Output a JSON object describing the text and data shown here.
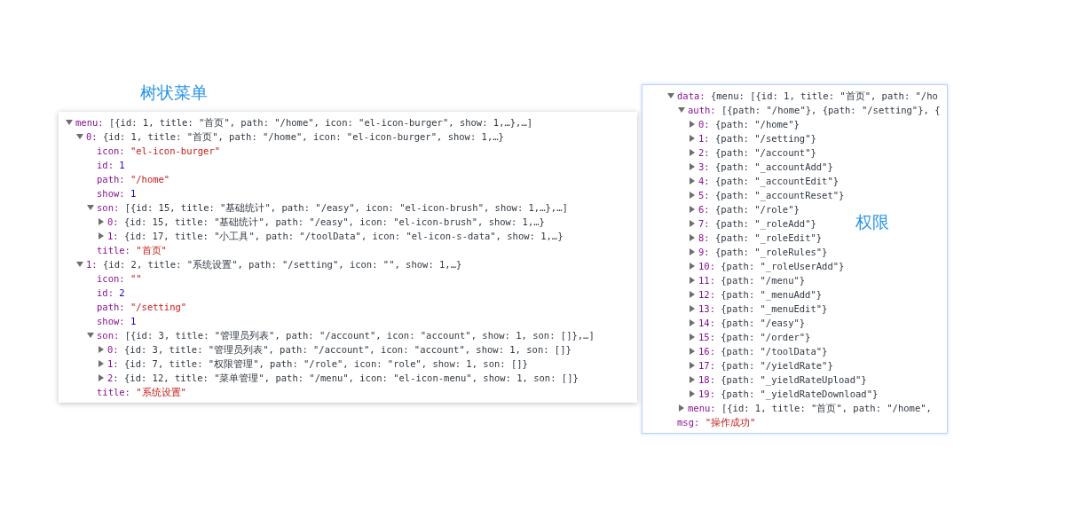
{
  "left": {
    "caption": "树状菜单",
    "tree": [
      {
        "key": "menu:",
        "value": "[{id: 1, title: \"首页\", path: \"/home\", icon: \"el-icon-burger\", show: 1,…},…]",
        "kind": "object",
        "expanded": true,
        "children": [
          {
            "key": "0:",
            "value": "{id: 1, title: \"首页\", path: \"/home\", icon: \"el-icon-burger\", show: 1,…}",
            "kind": "object",
            "expanded": true,
            "children": [
              {
                "key": "icon:",
                "value": "\"el-icon-burger\"",
                "kind": "string"
              },
              {
                "key": "id:",
                "value": "1",
                "kind": "number"
              },
              {
                "key": "path:",
                "value": "\"/home\"",
                "kind": "string"
              },
              {
                "key": "show:",
                "value": "1",
                "kind": "number"
              },
              {
                "key": "son:",
                "value": "[{id: 15, title: \"基础统计\", path: \"/easy\", icon: \"el-icon-brush\", show: 1,…},…]",
                "kind": "object",
                "expanded": true,
                "children": [
                  {
                    "key": "0:",
                    "value": "{id: 15, title: \"基础统计\", path: \"/easy\", icon: \"el-icon-brush\", show: 1,…}",
                    "kind": "object",
                    "expanded": false
                  },
                  {
                    "key": "1:",
                    "value": "{id: 17, title: \"小工具\", path: \"/toolData\", icon: \"el-icon-s-data\", show: 1,…}",
                    "kind": "object",
                    "expanded": false
                  }
                ]
              },
              {
                "key": "title:",
                "value": "\"首页\"",
                "kind": "string"
              }
            ]
          },
          {
            "key": "1:",
            "value": "{id: 2, title: \"系统设置\", path: \"/setting\", icon: \"\", show: 1,…}",
            "kind": "object",
            "expanded": true,
            "children": [
              {
                "key": "icon:",
                "value": "\"\"",
                "kind": "string"
              },
              {
                "key": "id:",
                "value": "2",
                "kind": "number"
              },
              {
                "key": "path:",
                "value": "\"/setting\"",
                "kind": "string"
              },
              {
                "key": "show:",
                "value": "1",
                "kind": "number"
              },
              {
                "key": "son:",
                "value": "[{id: 3, title: \"管理员列表\", path: \"/account\", icon: \"account\", show: 1, son: []},…]",
                "kind": "object",
                "expanded": true,
                "children": [
                  {
                    "key": "0:",
                    "value": "{id: 3, title: \"管理员列表\", path: \"/account\", icon: \"account\", show: 1, son: []}",
                    "kind": "object",
                    "expanded": false
                  },
                  {
                    "key": "1:",
                    "value": "{id: 7, title: \"权限管理\", path: \"/role\", icon: \"role\", show: 1, son: []}",
                    "kind": "object",
                    "expanded": false
                  },
                  {
                    "key": "2:",
                    "value": "{id: 12, title: \"菜单管理\", path: \"/menu\", icon: \"el-icon-menu\", show: 1, son: []}",
                    "kind": "object",
                    "expanded": false
                  }
                ]
              },
              {
                "key": "title:",
                "value": "\"系统设置\"",
                "kind": "string"
              }
            ]
          }
        ]
      }
    ]
  },
  "right": {
    "caption": "权限",
    "tree": [
      {
        "key": "data:",
        "value": "{menu: [{id: 1, title: \"首页\", path: \"/ho",
        "kind": "object",
        "expanded": true,
        "children": [
          {
            "key": "auth:",
            "value": "[{path: \"/home\"}, {path: \"/setting\"}, {",
            "kind": "object",
            "expanded": true,
            "children": [
              {
                "key": "0:",
                "value": "{path: \"/home\"}",
                "kind": "object",
                "expanded": false
              },
              {
                "key": "1:",
                "value": "{path: \"/setting\"}",
                "kind": "object",
                "expanded": false
              },
              {
                "key": "2:",
                "value": "{path: \"/account\"}",
                "kind": "object",
                "expanded": false
              },
              {
                "key": "3:",
                "value": "{path: \"_accountAdd\"}",
                "kind": "object",
                "expanded": false
              },
              {
                "key": "4:",
                "value": "{path: \"_accountEdit\"}",
                "kind": "object",
                "expanded": false
              },
              {
                "key": "5:",
                "value": "{path: \"_accountReset\"}",
                "kind": "object",
                "expanded": false
              },
              {
                "key": "6:",
                "value": "{path: \"/role\"}",
                "kind": "object",
                "expanded": false
              },
              {
                "key": "7:",
                "value": "{path: \"_roleAdd\"}",
                "kind": "object",
                "expanded": false
              },
              {
                "key": "8:",
                "value": "{path: \"_roleEdit\"}",
                "kind": "object",
                "expanded": false
              },
              {
                "key": "9:",
                "value": "{path: \"_roleRules\"}",
                "kind": "object",
                "expanded": false
              },
              {
                "key": "10:",
                "value": "{path: \"_roleUserAdd\"}",
                "kind": "object",
                "expanded": false
              },
              {
                "key": "11:",
                "value": "{path: \"/menu\"}",
                "kind": "object",
                "expanded": false
              },
              {
                "key": "12:",
                "value": "{path: \"_menuAdd\"}",
                "kind": "object",
                "expanded": false
              },
              {
                "key": "13:",
                "value": "{path: \"_menuEdit\"}",
                "kind": "object",
                "expanded": false
              },
              {
                "key": "14:",
                "value": "{path: \"/easy\"}",
                "kind": "object",
                "expanded": false
              },
              {
                "key": "15:",
                "value": "{path: \"/order\"}",
                "kind": "object",
                "expanded": false
              },
              {
                "key": "16:",
                "value": "{path: \"/toolData\"}",
                "kind": "object",
                "expanded": false
              },
              {
                "key": "17:",
                "value": "{path: \"/yieldRate\"}",
                "kind": "object",
                "expanded": false
              },
              {
                "key": "18:",
                "value": "{path: \"_yieldRateUpload\"}",
                "kind": "object",
                "expanded": false
              },
              {
                "key": "19:",
                "value": "{path: \"_yieldRateDownload\"}",
                "kind": "object",
                "expanded": false
              }
            ]
          },
          {
            "key": "menu:",
            "value": "[{id: 1, title: \"首页\", path: \"/home\",",
            "kind": "object",
            "expanded": false
          }
        ]
      },
      {
        "key": "msg:",
        "value": "\"操作成功\"",
        "kind": "string"
      }
    ]
  }
}
